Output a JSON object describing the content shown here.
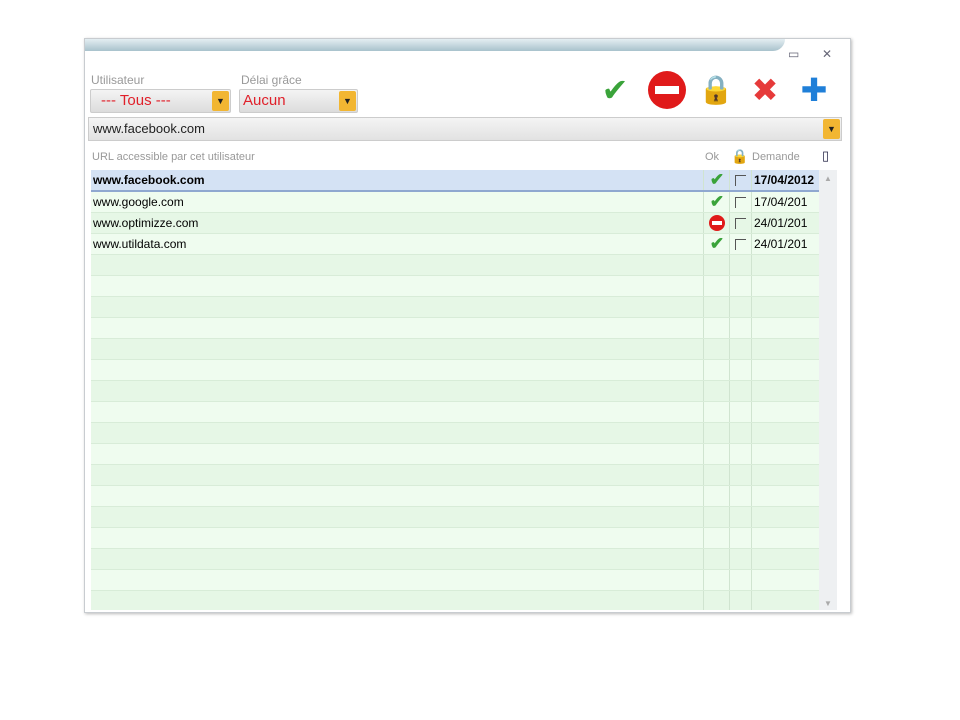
{
  "window": {
    "minimize": "▭",
    "close": "✕"
  },
  "filters": {
    "user_label": "Utilisateur",
    "user_value": "--- Tous ---",
    "grace_label": "Délai grâce",
    "grace_value": "Aucun"
  },
  "toolbar": {
    "approve": "✔",
    "block": "",
    "lock": "🔒",
    "delete": "✖",
    "add": "✚"
  },
  "url_input": {
    "value": "www.facebook.com"
  },
  "table": {
    "headers": {
      "url": "URL accessible par cet utilisateur",
      "ok": "Ok",
      "lock": "🔒",
      "date": "Demande"
    },
    "rows": [
      {
        "url": "www.facebook.com",
        "status": "ok",
        "date": "17/04/2012",
        "selected": true
      },
      {
        "url": "www.google.com",
        "status": "ok",
        "date": "17/04/201",
        "selected": false
      },
      {
        "url": "www.optimizze.com",
        "status": "blocked",
        "date": "24/01/201",
        "selected": false
      },
      {
        "url": "www.utildata.com",
        "status": "ok",
        "date": "24/01/201",
        "selected": false
      }
    ]
  }
}
